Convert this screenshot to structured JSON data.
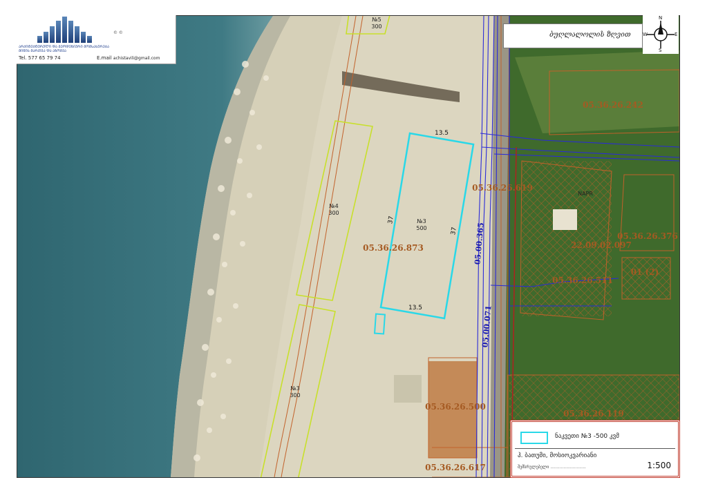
{
  "logo": {
    "lines": [
      "ᲐᲠᲥᲘᲢᲔᲥᲢᲣᲠᲣᲚᲘ ᲓᲐ ᲒᲔᲝᲓᲔᲖᲘᲣᲠᲘ ᲛᲝᲛᲡᲐᲮᲣᲠᲔᲑᲐ",
      "ᲛᲘᲬᲘᲡ ᲛᲐᲠᲗᲕᲐ ᲓᲐ ᲐᲖᲝᲛᲕᲐ"
    ],
    "mark": "© ©",
    "phone": "Tel.  577 65 79 74",
    "email_label": "E.mail",
    "email": "achistavili@gmail.com"
  },
  "header": {
    "place_name": "ბუღლალოლის ზღვით"
  },
  "compass": {
    "n": "N",
    "s": "S",
    "e": "E",
    "w": "W"
  },
  "map": {
    "zones": [
      {
        "number": "№5",
        "area": "300"
      },
      {
        "number": "№4",
        "area": "300"
      },
      {
        "number": "№3",
        "area": "500"
      },
      {
        "number": "№3",
        "area": "300"
      }
    ],
    "dimensions": {
      "top": "13.5",
      "bottom": "13.5",
      "left": "37",
      "right": "37"
    },
    "parcels": [
      "05.36.26.242",
      "05.36.26.619",
      "05.36.26.873",
      "05.36.26.376",
      "22.09.02.097",
      "05.36.26.511",
      "01 (2)",
      "05.36.26.500",
      "05.36.26.119",
      "05.36.26.617"
    ],
    "roads": [
      "05.00.365",
      "05.00.071"
    ],
    "napr": "NAPR"
  },
  "legend": {
    "item_label": "ნაკვეთი  №3  -500  კვმ",
    "prepared_by": "ჰ. ბათუმი,  მოსიოკვარიანი",
    "signature": "შემსრულებელი ...........................",
    "scale": "1:500"
  },
  "colors": {
    "sea": "#3d7480",
    "sand": "#d8d2ba",
    "vegetation": "#3f6a2c",
    "selected_plot": "#29d8e8",
    "zone_outline": "#c8e02a",
    "parcel_line": "#c2612a",
    "road_line": "#2a2ad8"
  }
}
